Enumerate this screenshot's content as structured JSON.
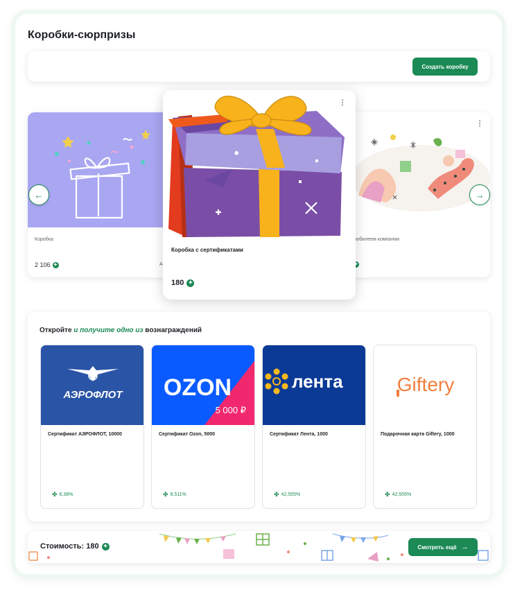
{
  "page": {
    "title": "Коробки-сюрпризы"
  },
  "toolbar": {
    "create_label": "Создать коробку"
  },
  "carousel": {
    "left_card": {
      "label": "Коробка",
      "price": "2 106",
      "side_letter": "А"
    },
    "center_card": {
      "title": "Коробка с сертификатами",
      "price": "180"
    },
    "right_card": {
      "label": "юбилеем компании"
    },
    "prev_arrow": "←",
    "next_arrow": "→"
  },
  "rewards": {
    "title_before": "Откройте ",
    "title_highlight": "и получите одно из",
    "title_after": " вознаграждений",
    "items": [
      {
        "name": "Сертификат АЭРОФЛОТ, 10000",
        "percent": "6,38%",
        "logo_text": "АЭРОФЛОТ",
        "bg": "#2a54a6"
      },
      {
        "name": "Сертификат Ozon, 5000",
        "percent": "8,511%",
        "logo_text": "OZON",
        "badge": "5 000 ₽",
        "bg": "#0a5bff"
      },
      {
        "name": "Сертификат Лента, 1000",
        "percent": "42,555%",
        "logo_text": "лента",
        "bg": "#0b3a96"
      },
      {
        "name": "Подарочная карта Giftery, 1000",
        "percent": "42,555%",
        "logo_text": "Giftery",
        "bg": "#ffffff"
      }
    ]
  },
  "bottom": {
    "cost_label": "Стоимость: 180",
    "more_label": "Смотреть ещё"
  },
  "colors": {
    "accent": "#1b8a55",
    "purple_box": "#7b5cb8",
    "ribbon": "#f7b32b"
  }
}
